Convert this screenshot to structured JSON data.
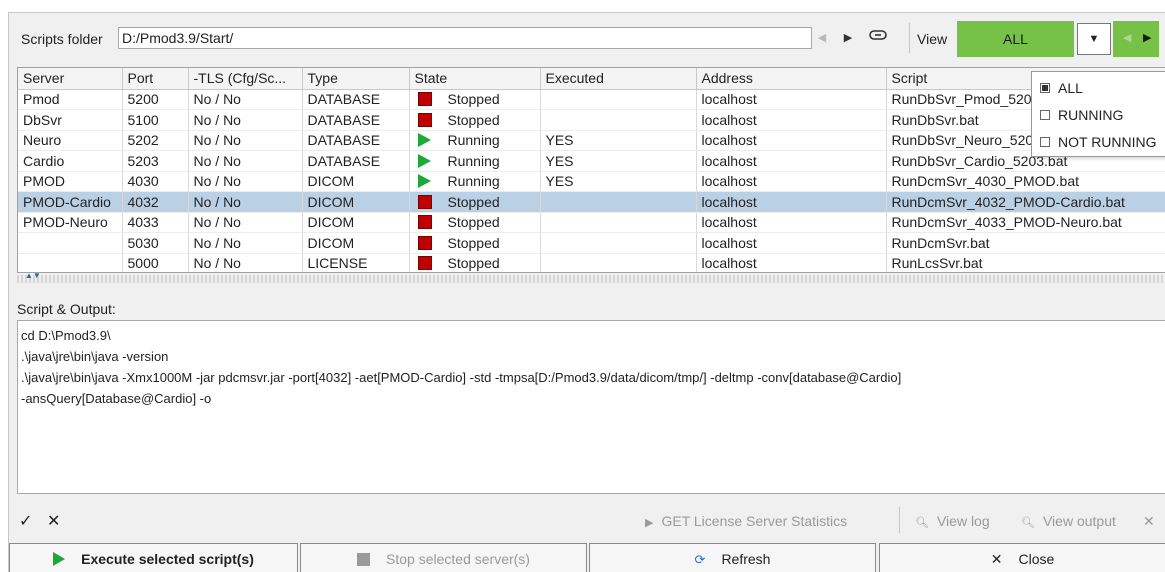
{
  "toolbar": {
    "folder_label": "Scripts folder",
    "folder_value": "D:/Pmod3.9/Start/",
    "view_label": "View",
    "view_value": "ALL"
  },
  "view_options": [
    {
      "label": "ALL",
      "checked": true
    },
    {
      "label": "RUNNING",
      "checked": false
    },
    {
      "label": "NOT RUNNING",
      "checked": false
    }
  ],
  "table": {
    "columns": [
      "Server",
      "Port",
      "-TLS (Cfg/Sc...",
      "Type",
      "State",
      "Executed",
      "Address",
      "Script"
    ],
    "rows": [
      {
        "server": "Pmod",
        "port": "5200",
        "tls": "No / No",
        "type": "DATABASE",
        "state": "Stopped",
        "executed": "",
        "address": "localhost",
        "script": "RunDbSvr_Pmod_5200.bat",
        "selected": false
      },
      {
        "server": "DbSvr",
        "port": "5100",
        "tls": "No / No",
        "type": "DATABASE",
        "state": "Stopped",
        "executed": "",
        "address": "localhost",
        "script": "RunDbSvr.bat",
        "selected": false
      },
      {
        "server": "Neuro",
        "port": "5202",
        "tls": "No / No",
        "type": "DATABASE",
        "state": "Running",
        "executed": "YES",
        "address": "localhost",
        "script": "RunDbSvr_Neuro_5202.bat",
        "selected": false
      },
      {
        "server": "Cardio",
        "port": "5203",
        "tls": "No / No",
        "type": "DATABASE",
        "state": "Running",
        "executed": "YES",
        "address": "localhost",
        "script": "RunDbSvr_Cardio_5203.bat",
        "selected": false
      },
      {
        "server": "PMOD",
        "port": "4030",
        "tls": "No / No",
        "type": "DICOM",
        "state": "Running",
        "executed": "YES",
        "address": "localhost",
        "script": "RunDcmSvr_4030_PMOD.bat",
        "selected": false
      },
      {
        "server": "PMOD-Cardio",
        "port": "4032",
        "tls": "No / No",
        "type": "DICOM",
        "state": "Stopped",
        "executed": "",
        "address": "localhost",
        "script": "RunDcmSvr_4032_PMOD-Cardio.bat",
        "selected": true
      },
      {
        "server": "PMOD-Neuro",
        "port": "4033",
        "tls": "No / No",
        "type": "DICOM",
        "state": "Stopped",
        "executed": "",
        "address": "localhost",
        "script": "RunDcmSvr_4033_PMOD-Neuro.bat",
        "selected": false
      },
      {
        "server": "",
        "port": "5030",
        "tls": "No / No",
        "type": "DICOM",
        "state": "Stopped",
        "executed": "",
        "address": "localhost",
        "script": "RunDcmSvr.bat",
        "selected": false
      },
      {
        "server": "",
        "port": "5000",
        "tls": "No / No",
        "type": "LICENSE",
        "state": "Stopped",
        "executed": "",
        "address": "localhost",
        "script": "RunLcsSvr.bat",
        "selected": false
      }
    ]
  },
  "output": {
    "label": "Script & Output:",
    "lines": [
      "cd D:\\Pmod3.9\\",
      ".\\java\\jre\\bin\\java -version",
      ".\\java\\jre\\bin\\java -Xmx1000M -jar pdcmsvr.jar -port[4032] -aet[PMOD-Cardio] -std -tmpsa[D:/Pmod3.9/data/dicom/tmp/] -deltmp -conv[database@Cardio]",
      "-ansQuery[Database@Cardio] -o"
    ]
  },
  "mini_toolbar": {
    "get_stats": "GET License Server Statistics",
    "view_log": "View log",
    "view_output": "View output"
  },
  "buttons": {
    "execute": "Execute selected script(s)",
    "stop": "Stop selected server(s)",
    "refresh": "Refresh",
    "close": "Close"
  },
  "colors": {
    "view_accent": "#76c148",
    "stopped": "#c00000",
    "running": "#1ea83a",
    "selected_row": "#bad0e4"
  }
}
